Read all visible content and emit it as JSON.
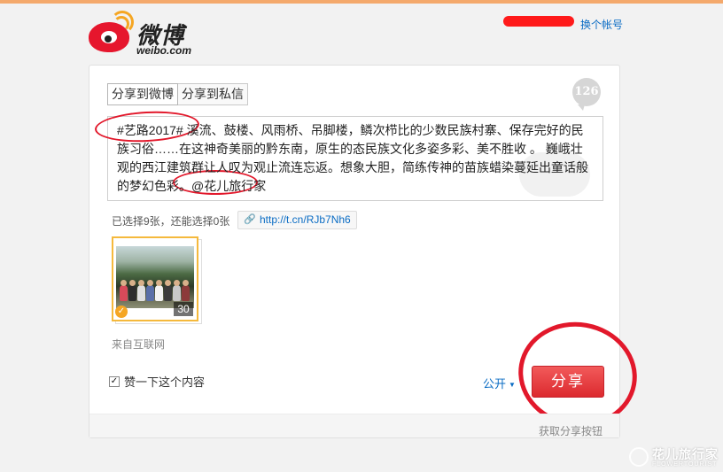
{
  "header": {
    "brand_cn": "微博",
    "brand_en": "weibo.com",
    "switch_account": "换个帐号"
  },
  "composer": {
    "tabs": [
      {
        "label": "分享到微博",
        "active": true
      },
      {
        "label": "分享到私信",
        "active": false
      }
    ],
    "char_count": "126",
    "text": {
      "hashtag": "#艺路2017#",
      "body": " 溪流、鼓楼、风雨桥、吊脚楼，鳞次栉比的少数民族村寨、保存完好的民族习俗……在这神奇美丽的黔东南，原生的态民族文化多姿多彩、美不胜收 。 巍峨壮观的西江建筑群让人叹为观止流连忘返。想象大胆，简练传神的苗族蜡染蔓延出童话般的梦幻色彩。",
      "mention": "@花儿旅行家"
    },
    "image_selection": "已选择9张，还能选择0张",
    "short_link": "http://t.cn/RJb7Nh6",
    "thumbnail_count": "30",
    "source": "来自互联网",
    "like_checkbox_label": "赞一下这个内容",
    "like_checked": true,
    "privacy": "公开",
    "share_button": "分享",
    "footer_text": "获取分享按钮"
  },
  "watermark": {
    "cn": "花儿旅行家",
    "en": "FLOWERTOURIST"
  },
  "colors": {
    "accent_red": "#e2182b",
    "link_blue": "#0a6cc4",
    "selection_orange": "#f5b93c"
  }
}
